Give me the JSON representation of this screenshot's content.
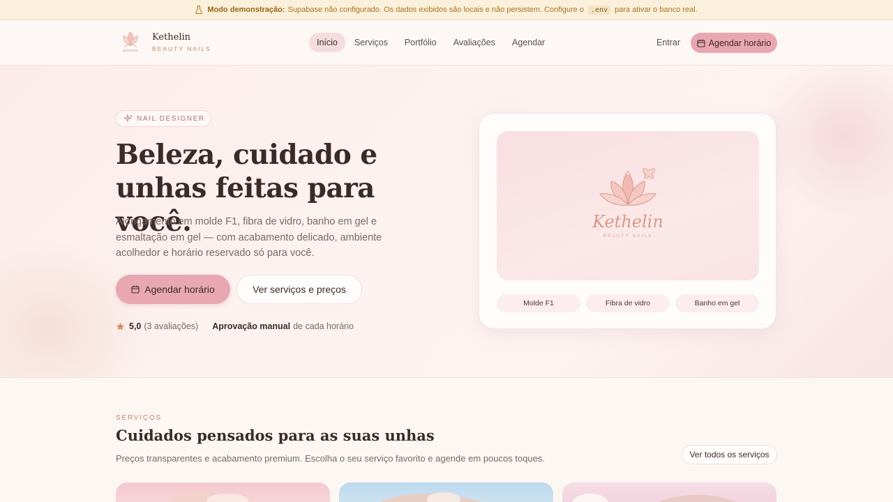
{
  "banner": {
    "label": "Modo demonstração:",
    "text_before": "Supabase não configurado. Os dados exibidos são locais e não persistem. Configure o",
    "code": ".env",
    "text_after": "para ativar o banco real."
  },
  "brand": {
    "name": "Kethelin",
    "subtitle": "BEAUTY NAILS"
  },
  "nav": {
    "items": [
      {
        "label": "Início",
        "active": true
      },
      {
        "label": "Serviços"
      },
      {
        "label": "Portfólio"
      },
      {
        "label": "Avaliações"
      },
      {
        "label": "Agendar"
      }
    ],
    "login_label": "Entrar",
    "cta_label": "Agendar horário"
  },
  "hero": {
    "tag": "NAIL DESIGNER",
    "title_line1": "Beleza, cuidado e",
    "title_line2": "unhas feitas para você.",
    "description": "Alongamento em molde F1, fibra de vidro, banho em gel e esmaltação em gel — com acabamento delicado, ambiente acolhedor e horário reservado só para você.",
    "primary_cta": "Agendar horário",
    "secondary_cta": "Ver serviços e preços",
    "rating_value": "5,0",
    "rating_count": "(3 avaliações)",
    "approval_bold": "Aprovação manual",
    "approval_rest": "de cada horário"
  },
  "hero_card": {
    "logo_name": "Kethelin",
    "logo_subtitle": "BEAUTY NAILS",
    "chips": [
      "Molde F1",
      "Fibra de vidro",
      "Banho em gel"
    ]
  },
  "services": {
    "label": "SERVIÇOS",
    "title": "Cuidados pensados para as suas unhas",
    "description": "Preços transparentes e acabamento premium. Escolha o seu serviço favorito e agende em poucos toques.",
    "all_button": "Ver todos os serviços"
  },
  "colors": {
    "accent": "#e9a7b2",
    "banner_bg": "#fbf0dc",
    "gold": "#c0876b"
  }
}
